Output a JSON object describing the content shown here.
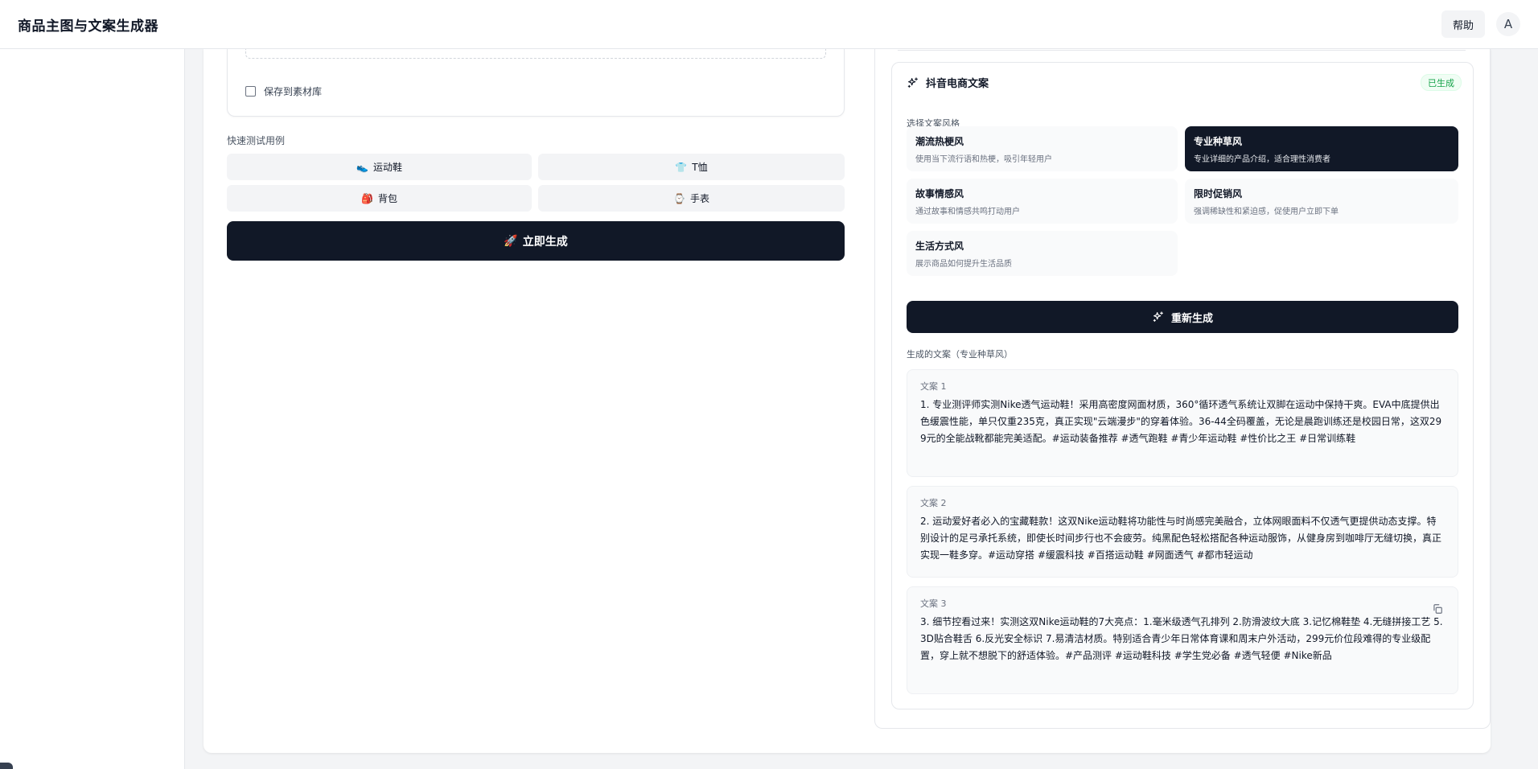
{
  "header": {
    "title": "商品主图与文案生成器",
    "help_label": "帮助",
    "avatar_initial": "A"
  },
  "left": {
    "save_to_library_label": "保存到素材库",
    "quick_tests_label": "快速测试用例",
    "quick_tests": [
      {
        "emoji": "👟",
        "label": "运动鞋"
      },
      {
        "emoji": "👕",
        "label": "T恤"
      },
      {
        "emoji": "🎒",
        "label": "背包"
      },
      {
        "emoji": "⌚",
        "label": "手表"
      }
    ],
    "generate_emoji": "🚀",
    "generate_label": "立即生成"
  },
  "copy_panel": {
    "title": "抖音电商文案",
    "status": "已生成",
    "style_caption": "选择文案风格",
    "styles": [
      {
        "name": "潮流热梗风",
        "desc": "使用当下流行语和热梗，吸引年轻用户",
        "selected": false
      },
      {
        "name": "专业种草风",
        "desc": "专业详细的产品介绍，适合理性消费者",
        "selected": true
      },
      {
        "name": "故事情感风",
        "desc": "通过故事和情感共鸣打动用户",
        "selected": false
      },
      {
        "name": "限时促销风",
        "desc": "强调稀缺性和紧迫感，促使用户立即下单",
        "selected": false
      },
      {
        "name": "生活方式风",
        "desc": "展示商品如何提升生活品质",
        "selected": false
      }
    ],
    "regenerate_label": "重新生成",
    "results_caption": "生成的文案（专业种草风）",
    "results": [
      {
        "label": "文案 1",
        "text": "1. 专业测评师实测Nike透气运动鞋！采用高密度网面材质，360°循环透气系统让双脚在运动中保持干爽。EVA中底提供出色缓震性能，单只仅重235克，真正实现\"云端漫步\"的穿着体验。36-44全码覆盖，无论是晨跑训练还是校园日常，这双299元的全能战靴都能完美适配。#运动装备推荐 #透气跑鞋 #青少年运动鞋 #性价比之王 #日常训练鞋"
      },
      {
        "label": "文案 2",
        "text": "2. 运动爱好者必入的宝藏鞋款！这双Nike运动鞋将功能性与时尚感完美融合，立体网眼面料不仅透气更提供动态支撑。特别设计的足弓承托系统，即使长时间步行也不会疲劳。纯黑配色轻松搭配各种运动服饰，从健身房到咖啡厅无缝切换，真正实现一鞋多穿。#运动穿搭 #缓震科技 #百搭运动鞋 #网面透气 #都市轻运动"
      },
      {
        "label": "文案 3",
        "text": "3. 细节控看过来！实测这双Nike运动鞋的7大亮点：1.毫米级透气孔排列 2.防滑波纹大底 3.记忆棉鞋垫 4.无缝拼接工艺 5.3D贴合鞋舌 6.反光安全标识 7.易清洁材质。特别适合青少年日常体育课和周末户外活动，299元价位段难得的专业级配置，穿上就不想脱下的舒适体验。#产品测评 #运动鞋科技 #学生党必备 #透气轻便 #Nike新品"
      }
    ]
  }
}
